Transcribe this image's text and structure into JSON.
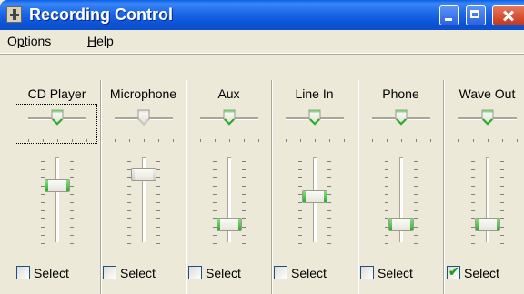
{
  "window": {
    "title": "Recording Control",
    "colors": {
      "titlebar": "#0A52D6",
      "face": "#ECE9D8",
      "active_slider": "#28B028",
      "close_button": "#C4381B"
    }
  },
  "menu": {
    "options_prefix": "O",
    "options_accel": "p",
    "options_rest": "tions",
    "help_accel": "H",
    "help_rest": "elp"
  },
  "channels": [
    {
      "name": "CD Player",
      "balance": 0.5,
      "volume": 0.7,
      "active": true,
      "selected": false,
      "focused": true
    },
    {
      "name": "Microphone",
      "balance": 0.5,
      "volume": 0.85,
      "active": false,
      "selected": false,
      "focused": false
    },
    {
      "name": "Aux",
      "balance": 0.5,
      "volume": 0.15,
      "active": true,
      "selected": false,
      "focused": false
    },
    {
      "name": "Line In",
      "balance": 0.5,
      "volume": 0.55,
      "active": true,
      "selected": false,
      "focused": false
    },
    {
      "name": "Phone",
      "balance": 0.5,
      "volume": 0.15,
      "active": true,
      "selected": false,
      "focused": false
    },
    {
      "name": "Wave Out",
      "balance": 0.5,
      "volume": 0.15,
      "active": true,
      "selected": true,
      "focused": false
    }
  ],
  "select": {
    "accel": "S",
    "rest": "elect"
  },
  "icons": {
    "app": "volume-control-icon",
    "minimize": "minimize-icon",
    "maximize": "maximize-icon",
    "close": "close-icon",
    "check": "checkmark-icon"
  }
}
